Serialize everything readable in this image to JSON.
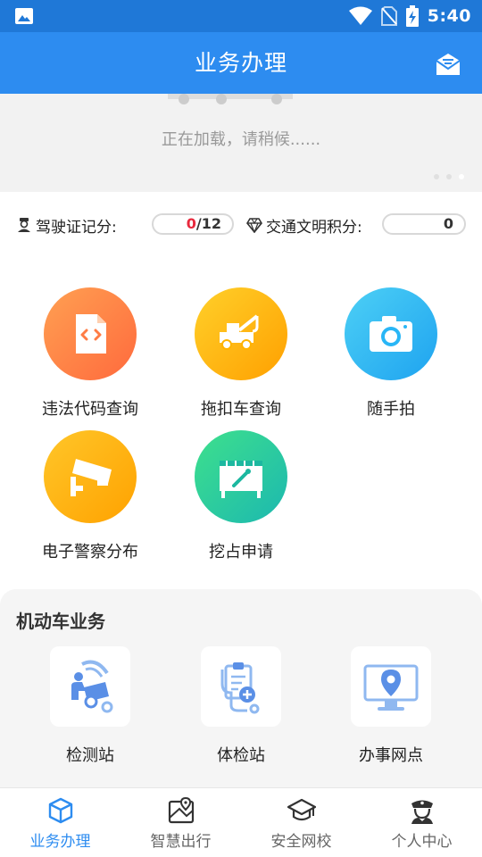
{
  "status_bar": {
    "time": "5:40"
  },
  "header": {
    "title": "业务办理"
  },
  "banner": {
    "loading_text": "正在加载，请稍候......"
  },
  "scores": {
    "license": {
      "label": "驾驶证记分:",
      "current": "0",
      "total": "/12"
    },
    "civility": {
      "label": "交通文明积分:",
      "value": "0"
    }
  },
  "services": [
    {
      "label": "违法代码查询",
      "icon": "code-document-icon",
      "color": "#ff7c45"
    },
    {
      "label": "拖扣车查询",
      "icon": "tow-truck-icon",
      "color": "#ffb300"
    },
    {
      "label": "随手拍",
      "icon": "camera-icon",
      "color": "#29b6f6"
    },
    {
      "label": "电子警察分布",
      "icon": "surveillance-camera-icon",
      "color": "#ffae00"
    },
    {
      "label": "挖占申请",
      "icon": "construction-board-icon",
      "color": "#26c6a6"
    }
  ],
  "motor_vehicle": {
    "title": "机动车业务",
    "items": [
      {
        "label": "检测站",
        "icon": "inspection-station-icon"
      },
      {
        "label": "体检站",
        "icon": "medical-checkup-icon"
      },
      {
        "label": "办事网点",
        "icon": "service-location-icon"
      }
    ]
  },
  "nav": [
    {
      "label": "业务办理",
      "icon": "cube-icon",
      "active": true
    },
    {
      "label": "智慧出行",
      "icon": "map-icon",
      "active": false
    },
    {
      "label": "安全网校",
      "icon": "graduation-cap-icon",
      "active": false
    },
    {
      "label": "个人中心",
      "icon": "police-officer-icon",
      "active": false
    }
  ]
}
